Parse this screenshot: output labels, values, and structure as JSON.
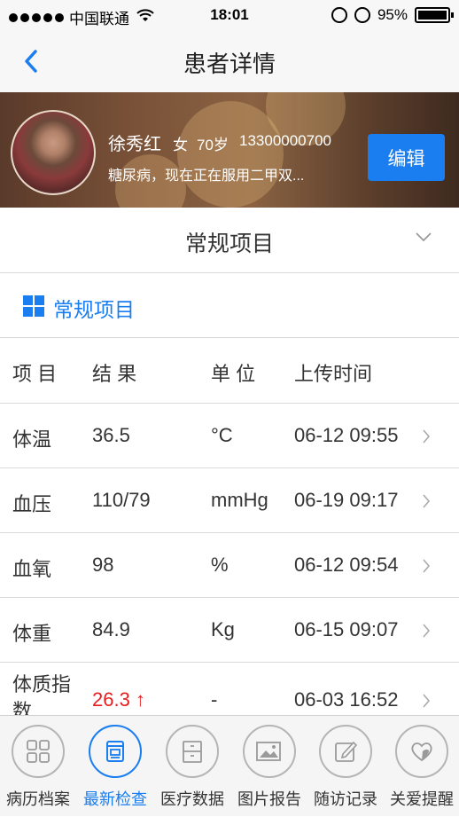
{
  "status_bar": {
    "carrier": "中国联通",
    "time": "18:01",
    "battery": "95%"
  },
  "nav": {
    "title": "患者详情"
  },
  "patient": {
    "name": "徐秀红",
    "gender": "女",
    "age": "70岁",
    "phone": "13300000700",
    "description": "糖尿病，现在正在服用二甲双...",
    "edit_label": "编辑"
  },
  "section_selector": {
    "label": "常规项目"
  },
  "category": {
    "label": "常规项目"
  },
  "table": {
    "headers": [
      "项  目",
      "结  果",
      "单  位",
      "上传时间"
    ],
    "rows": [
      {
        "item": "体温",
        "result": "36.5",
        "unit": "°C",
        "time": "06-12 09:55"
      },
      {
        "item": "血压",
        "result": "110/79",
        "unit": "mmHg",
        "time": "06-19 09:17"
      },
      {
        "item": "血氧",
        "result": "98",
        "unit": "%",
        "time": "06-12 09:54"
      },
      {
        "item": "体重",
        "result": "84.9",
        "unit": "Kg",
        "time": "06-15 09:07"
      },
      {
        "item": "体质指数",
        "result": "26.3 ↑",
        "unit": "-",
        "time": "06-03 16:52"
      }
    ]
  },
  "tabs": [
    {
      "label": "病历档案",
      "icon": "grid-icon"
    },
    {
      "label": "最新检查",
      "icon": "report-icon",
      "active": true
    },
    {
      "label": "医疗数据",
      "icon": "cabinet-icon"
    },
    {
      "label": "图片报告",
      "icon": "image-icon"
    },
    {
      "label": "随访记录",
      "icon": "edit-icon"
    },
    {
      "label": "关爱提醒",
      "icon": "heart-icon"
    }
  ],
  "colors": {
    "accent": "#1a7ef0",
    "abnormal": "#e81e1e"
  }
}
